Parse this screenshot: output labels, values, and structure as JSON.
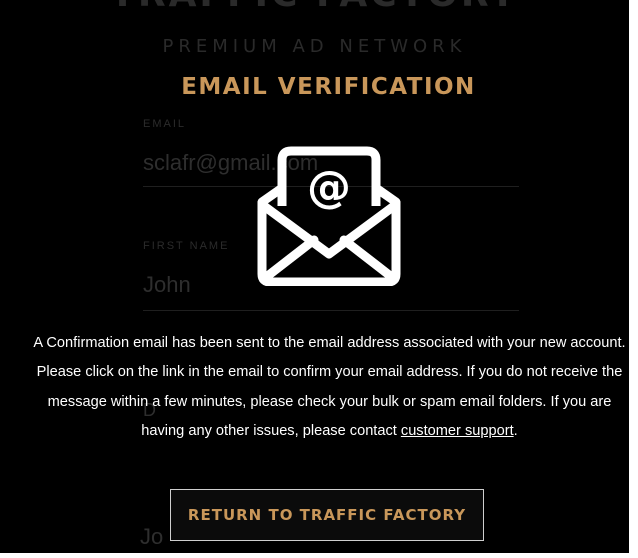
{
  "background_page": {
    "brand_title": "TRAFFIC FACTORY",
    "brand_subtitle": "PREMIUM AD NETWORK",
    "fields": [
      {
        "label": "EMAIL",
        "value": "sclafr@gmail.com"
      },
      {
        "label": "FIRST NAME",
        "value": "John"
      },
      {
        "label": "",
        "value": "D"
      },
      {
        "label": "",
        "value": "Jo"
      }
    ]
  },
  "modal": {
    "heading": "EMAIL VERIFICATION",
    "icon": "envelope-at-icon",
    "message_text": "A Confirmation email has been sent to the email address associated with your new account. Please click on the link in the email to confirm your email address. If you do not receive the message within a few minutes, please check your bulk or spam email folders. If you are having any other issues, please contact ",
    "support_link_text": "customer support",
    "message_end": ".",
    "return_button_label": "RETURN TO TRAFFIC FACTORY"
  },
  "colors": {
    "background": "#000000",
    "accent_gold": "#c9975a",
    "text": "#ffffff",
    "button_border": "#cfcfcf"
  }
}
